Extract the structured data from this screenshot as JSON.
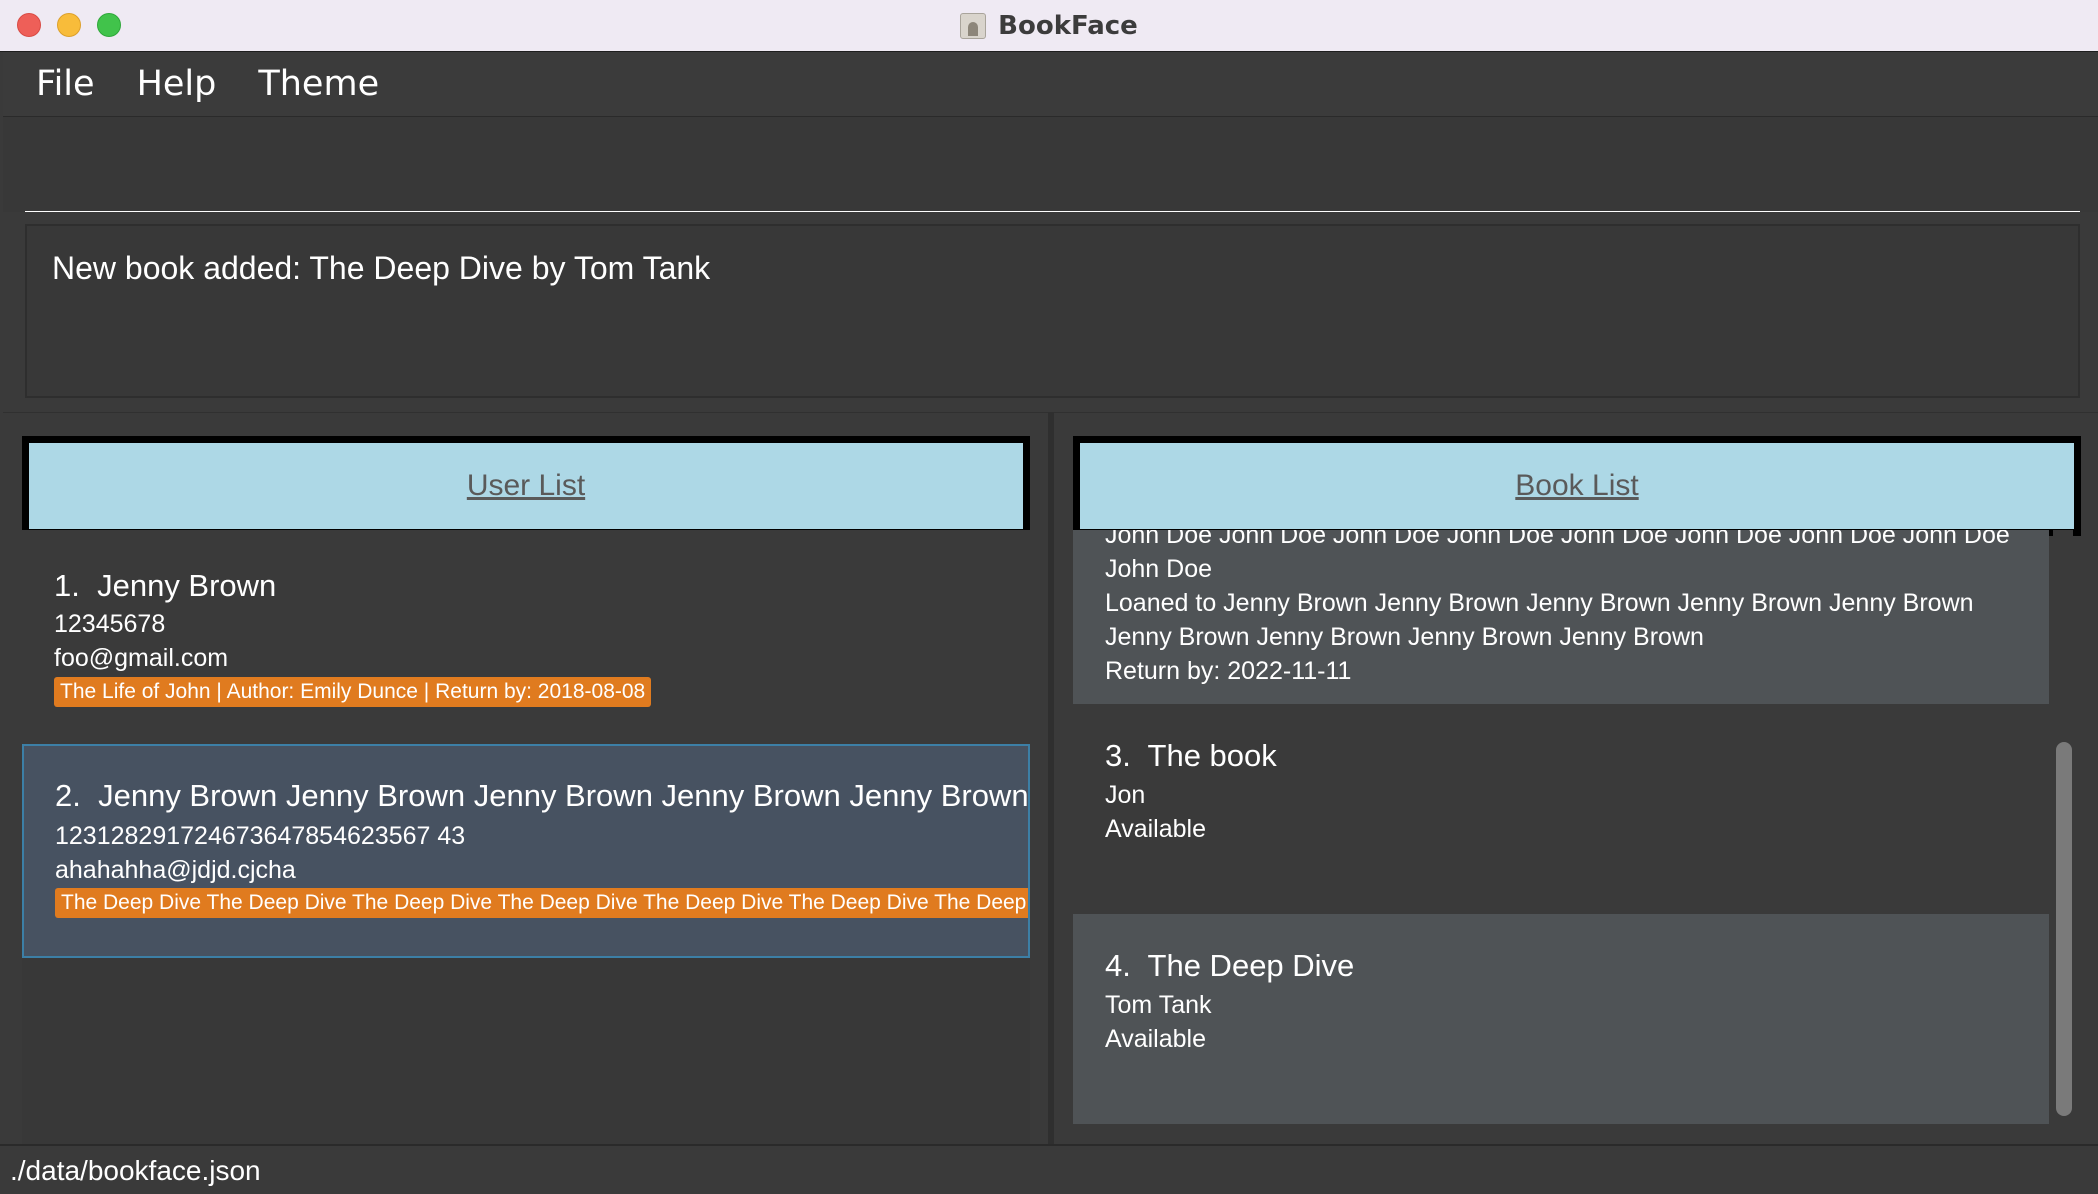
{
  "window": {
    "title": "BookFace"
  },
  "menu": {
    "items": [
      "File",
      "Help",
      "Theme"
    ]
  },
  "command": {
    "value": "",
    "placeholder": ""
  },
  "result": {
    "message": "New book added: The Deep Dive by Tom Tank"
  },
  "user_panel": {
    "header": "User List",
    "users": [
      {
        "index": "1.",
        "name": "Jenny Brown",
        "phone": "12345678",
        "email": "foo@gmail.com",
        "loan": "The Life of John | Author: Emily Dunce | Return by: 2018-08-08"
      },
      {
        "index": "2.",
        "name": "Jenny Brown Jenny Brown Jenny Brown Jenny Brown Jenny Brown Je",
        "phone": "123128291724673647854623567 43",
        "email": "ahahahha@jdjd.cjcha",
        "loan": "The Deep Dive The Deep Dive The Deep Dive The Deep Dive The Deep Dive The Deep Dive The Deep Div"
      }
    ]
  },
  "book_panel": {
    "header": "Book List",
    "partial_book": {
      "author": "John Doe John Doe John Doe John Doe John Doe John Doe John Doe John Doe John Doe",
      "loaned": "Loaned to Jenny Brown Jenny Brown Jenny Brown Jenny Brown Jenny Brown Jenny Brown Jenny Brown Jenny Brown Jenny Brown",
      "return_by": "Return by: 2022-11-11"
    },
    "books": [
      {
        "index": "3.",
        "title": "The book",
        "author": "Jon",
        "status": "Available"
      },
      {
        "index": "4.",
        "title": "The Deep Dive",
        "author": "Tom Tank",
        "status": "Available"
      }
    ]
  },
  "status_bar": {
    "path": "./data/bookface.json"
  },
  "colors": {
    "accent_header": "#add8e6",
    "tag_orange": "#e07b1f",
    "selected_row": "#475261",
    "selected_border": "#3c7fa6"
  },
  "icons": [
    "close-icon",
    "minimize-icon",
    "maximize-icon",
    "app-icon"
  ]
}
